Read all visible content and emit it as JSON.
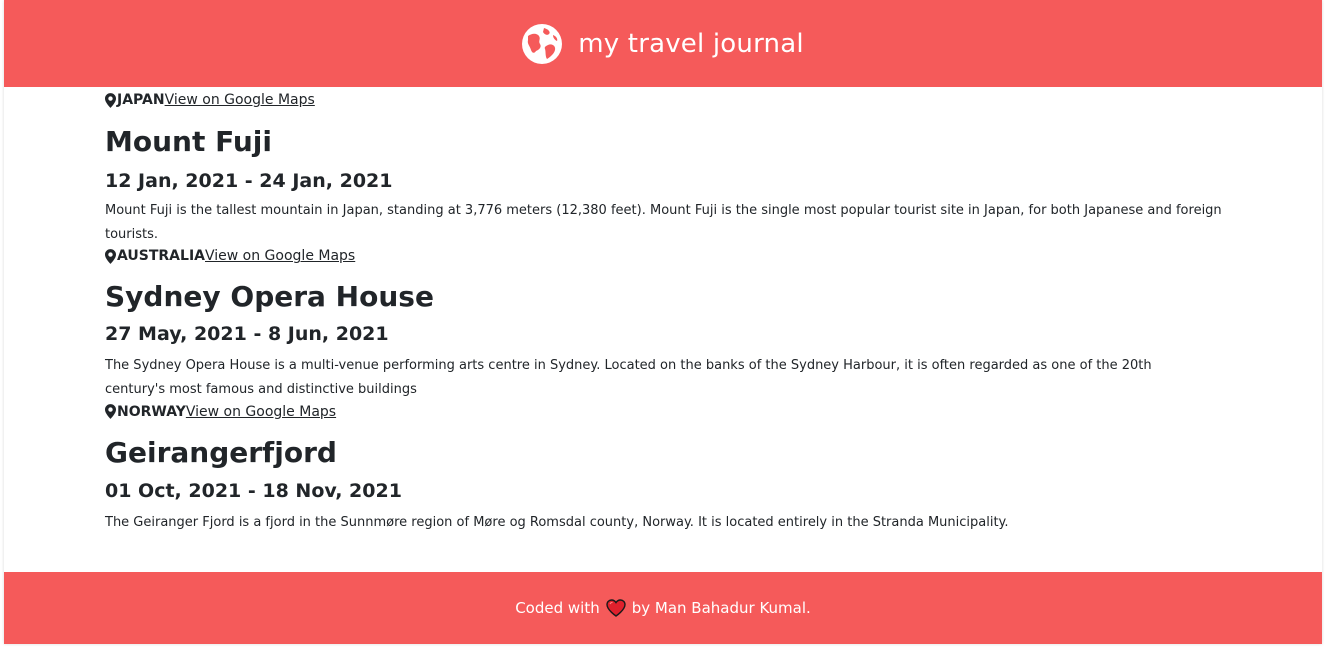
{
  "header": {
    "title": "my travel journal",
    "icon": "globe-icon",
    "bg": "#F55A5A"
  },
  "entries": [
    {
      "country": "JAPAN",
      "map_link": "View on Google Maps",
      "title": "Mount Fuji",
      "dates": "12 Jan, 2021 - 24 Jan, 2021",
      "description": "Mount Fuji is the tallest mountain in Japan, standing at 3,776 meters (12,380 feet). Mount Fuji is the single most popular tourist site in Japan, for both Japanese and foreign tourists."
    },
    {
      "country": "AUSTRALIA",
      "map_link": "View on Google Maps",
      "title": "Sydney Opera House",
      "dates": "27 May, 2021 - 8 Jun, 2021",
      "description": "The Sydney Opera House is a multi-venue performing arts centre in Sydney. Located on the banks of the Sydney Harbour, it is often regarded as one of the 20th century's most famous and distinctive buildings"
    },
    {
      "country": "NORWAY",
      "map_link": "View on Google Maps",
      "title": "Geirangerfjord",
      "dates": "01 Oct, 2021 - 18 Nov, 2021",
      "description": "The Geiranger Fjord is a fjord in the Sunnmøre region of Møre og Romsdal county, Norway. It is located entirely in the Stranda Municipality."
    }
  ],
  "footer": {
    "prefix": "Coded with",
    "suffix": "by Man Bahadur Kumal.",
    "icon": "heart-icon"
  }
}
